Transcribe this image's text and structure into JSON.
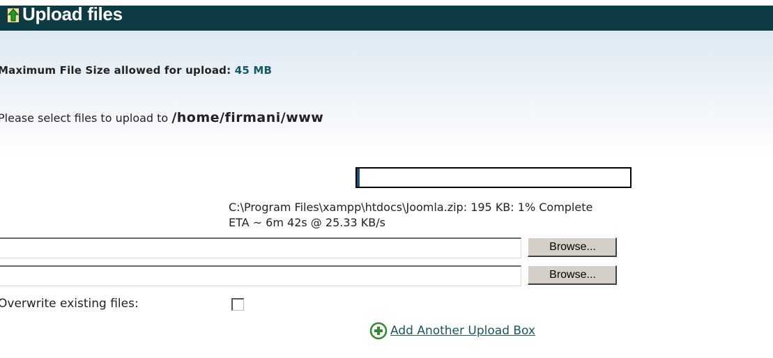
{
  "header": {
    "title": "Upload files",
    "icon": "upload-arrow-icon"
  },
  "max_size": {
    "label": "Maximum File Size allowed for upload:",
    "value": "45 MB"
  },
  "destination": {
    "label": "Please select files to upload to",
    "path": "/home/firmani/www"
  },
  "upload_progress": {
    "percent": 1,
    "status": "C:\\Program Files\\xampp\\htdocs\\Joomla.zip: 195 KB: 1% Complete",
    "eta": "ETA ~ 6m 42s @ 25.33 KB/s"
  },
  "file_rows": [
    {
      "value": "",
      "browse_label": "Browse..."
    },
    {
      "value": "",
      "browse_label": "Browse..."
    }
  ],
  "overwrite": {
    "label": "Overwrite existing files:",
    "checked": false
  },
  "add_box": {
    "label": "Add Another Upload Box",
    "icon": "plus-circle-icon"
  },
  "colors": {
    "header_bg": "#0c3b44",
    "accent_value": "#0f5a66",
    "link": "#1a5561",
    "add_icon_green": "#2e8b2e"
  }
}
